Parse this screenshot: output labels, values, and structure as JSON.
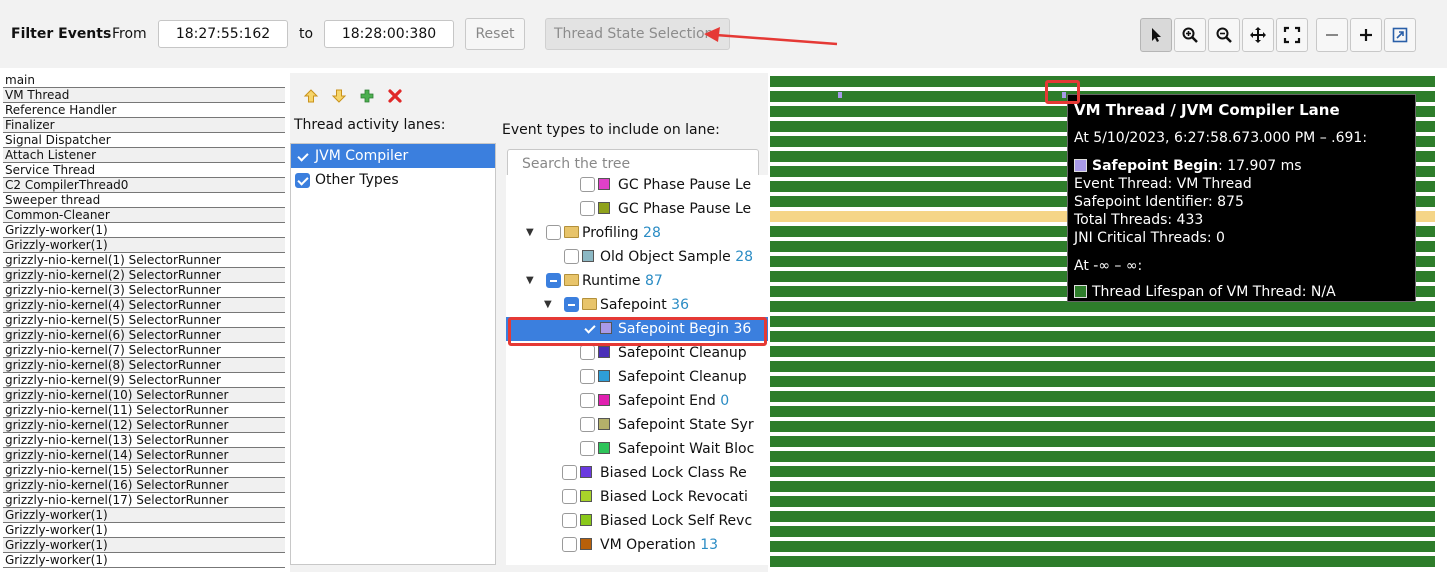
{
  "toolbar": {
    "filter_label": "Filter Events",
    "from_label": "From",
    "from_value": "18:27:55:162",
    "to_label": "to",
    "to_value": "18:28:00:380",
    "reset_label": "Reset",
    "thread_state_label": "Thread State Selection"
  },
  "threads": [
    "main",
    "VM Thread",
    "Reference Handler",
    "Finalizer",
    "Signal Dispatcher",
    "Attach Listener",
    "Service Thread",
    "C2 CompilerThread0",
    "Sweeper thread",
    "Common-Cleaner",
    "Grizzly-worker(1)",
    "Grizzly-worker(1)",
    "grizzly-nio-kernel(1) SelectorRunner",
    "grizzly-nio-kernel(2) SelectorRunner",
    "grizzly-nio-kernel(3) SelectorRunner",
    "grizzly-nio-kernel(4) SelectorRunner",
    "grizzly-nio-kernel(5) SelectorRunner",
    "grizzly-nio-kernel(6) SelectorRunner",
    "grizzly-nio-kernel(7) SelectorRunner",
    "grizzly-nio-kernel(8) SelectorRunner",
    "grizzly-nio-kernel(9) SelectorRunner",
    "grizzly-nio-kernel(10) SelectorRunner",
    "grizzly-nio-kernel(11) SelectorRunner",
    "grizzly-nio-kernel(12) SelectorRunner",
    "grizzly-nio-kernel(13) SelectorRunner",
    "grizzly-nio-kernel(14) SelectorRunner",
    "grizzly-nio-kernel(15) SelectorRunner",
    "grizzly-nio-kernel(16) SelectorRunner",
    "grizzly-nio-kernel(17) SelectorRunner",
    "Grizzly-worker(1)",
    "Grizzly-worker(1)",
    "Grizzly-worker(1)",
    "Grizzly-worker(1)"
  ],
  "dialog": {
    "lanes_title": "Thread activity lanes:",
    "lanes": [
      "JVM Compiler",
      "Other Types"
    ],
    "event_types_title": "Event types to include on lane:",
    "search_placeholder": "Search the tree",
    "tree": [
      {
        "label": "GC Phase Pause Le",
        "count": "",
        "color": "#e040c8"
      },
      {
        "label": "GC Phase Pause Le",
        "count": "",
        "color": "#8fa21c"
      },
      {
        "label": "Profiling",
        "count": "28",
        "color": ""
      },
      {
        "label": "Old Object Sample",
        "count": "28",
        "color": "#8cb8c4"
      },
      {
        "label": "Runtime",
        "count": "87",
        "color": ""
      },
      {
        "label": "Safepoint",
        "count": "36",
        "color": ""
      },
      {
        "label": "Safepoint Begin",
        "count": "36",
        "color": "#a89ae8"
      },
      {
        "label": "Safepoint Cleanup",
        "count": "",
        "color": "#4a2fb8"
      },
      {
        "label": "Safepoint Cleanup",
        "count": "",
        "color": "#2e9ed8"
      },
      {
        "label": "Safepoint End",
        "count": "0",
        "color": "#e020b0"
      },
      {
        "label": "Safepoint State Syr",
        "count": "",
        "color": "#b4b06a"
      },
      {
        "label": "Safepoint Wait Bloc",
        "count": "",
        "color": "#2ec45a"
      },
      {
        "label": "Biased Lock Class Re",
        "count": "",
        "color": "#6a3ae0"
      },
      {
        "label": "Biased Lock Revocati",
        "count": "",
        "color": "#a8d42a"
      },
      {
        "label": "Biased Lock Self Revc",
        "count": "",
        "color": "#8ac81a"
      },
      {
        "label": "VM Operation",
        "count": "13",
        "color": "#b8600a"
      }
    ]
  },
  "tooltip": {
    "title": "VM Thread / JVM Compiler Lane",
    "at": "At 5/10/2023, 6:27:58.673.000 PM – .691:",
    "event_name": "Safepoint Begin",
    "event_value": ": 17.907 ms",
    "event_thread": "Event Thread: VM Thread",
    "safepoint_id": "Safepoint Identifier: 875",
    "total_threads": "Total Threads: 433",
    "jni_threads": "JNI Critical Threads: 0",
    "at_range": "At -∞ – ∞:",
    "lifespan": "Thread Lifespan of VM Thread: N/A"
  },
  "colors": {
    "lane_green": "#2e7d2b",
    "lane_yellow": "#f5d587",
    "selection_blue": "#3b7fde",
    "annotation_red": "#e53935",
    "safepoint_begin": "#a89ae8"
  }
}
